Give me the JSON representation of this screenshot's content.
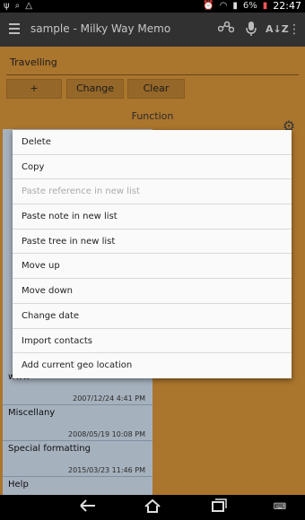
{
  "statusbar": {
    "battery": "6%",
    "time": "22:47"
  },
  "actionbar": {
    "title": "sample - Milky Way Memo"
  },
  "path": {
    "value": "Travelling"
  },
  "buttons": {
    "plus": "+",
    "change": "Change",
    "clear": "Clear"
  },
  "function_label": "Function",
  "list_items": [
    {
      "title": "www",
      "date": "2007/12/24 4:41 PM"
    },
    {
      "title": "Miscellany",
      "date": "2008/05/19 10:08 PM"
    },
    {
      "title": "Special formatting",
      "date": "2015/03/23 11:46 PM"
    },
    {
      "title": "Help",
      "date": ""
    }
  ],
  "context_menu": [
    {
      "label": "Delete",
      "enabled": true
    },
    {
      "label": "Copy",
      "enabled": true
    },
    {
      "label": "Paste reference in new list",
      "enabled": false
    },
    {
      "label": "Paste note in new list",
      "enabled": true
    },
    {
      "label": "Paste tree in new list",
      "enabled": true
    },
    {
      "label": "Move up",
      "enabled": true
    },
    {
      "label": "Move down",
      "enabled": true
    },
    {
      "label": "Change date",
      "enabled": true
    },
    {
      "label": "Import contacts",
      "enabled": true
    },
    {
      "label": "Add current geo location",
      "enabled": true
    }
  ],
  "icons": {
    "menu": "hamburger-icon",
    "graph": "share-nodes-icon",
    "mic": "microphone-icon",
    "sort": "sort-az-icon",
    "overflow": "overflow-icon",
    "settings": "gear-icon"
  },
  "colors": {
    "background": "#c88a36",
    "actionbar": "#3a3a3a",
    "list_background": "#c4d0e0"
  }
}
